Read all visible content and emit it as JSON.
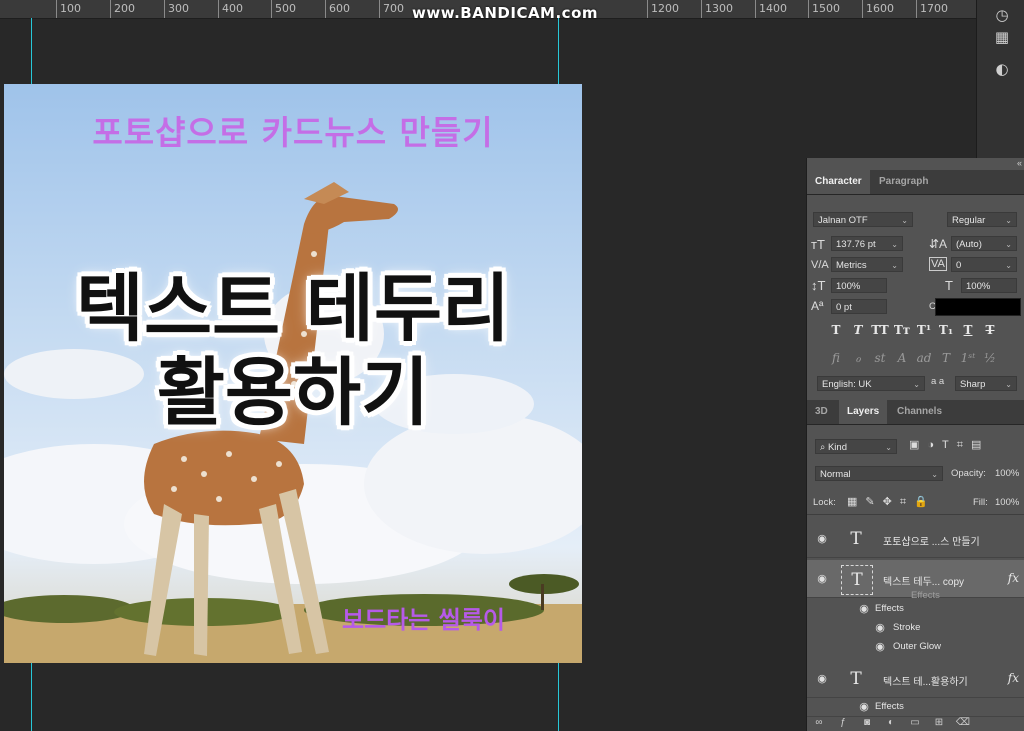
{
  "watermark": "www.BANDICAM.com",
  "ruler": {
    "labels": [
      "100",
      "200",
      "300",
      "400",
      "500",
      "600",
      "700",
      "1200",
      "1300",
      "1400",
      "1500",
      "1600",
      "1700"
    ]
  },
  "card": {
    "title": "포토샵으로 카드뉴스 만들기",
    "main_line1": "텍스트 테두리",
    "main_line2": "활용하기",
    "author": "보드타는 씰룩이"
  },
  "character_panel": {
    "tabs": [
      "Character",
      "Paragraph"
    ],
    "font_family": "Jalnan OTF",
    "font_style": "Regular",
    "font_size": "137.76 pt",
    "leading": "(Auto)",
    "kerning": "Metrics",
    "tracking": "0",
    "vertical_scale": "100%",
    "horizontal_scale": "100%",
    "baseline_shift": "0 pt",
    "color_label": "Color:",
    "color": "#000000",
    "language": "English: UK",
    "aa_label": "a a",
    "antialias": "Sharp"
  },
  "layers_panel": {
    "tabs": [
      "3D",
      "Layers",
      "Channels"
    ],
    "filter_kind": "Kind",
    "blend_mode": "Normal",
    "opacity_label": "Opacity:",
    "opacity": "100%",
    "lock_label": "Lock:",
    "fill_label": "Fill:",
    "fill": "100%",
    "layers": [
      {
        "name": "포토샵으로 ...스 만들기",
        "thumb": "T"
      },
      {
        "name": "텍스트 테두... copy",
        "thumb": "T",
        "fx": "fx",
        "drag_ghost": "Effects"
      },
      {
        "name": "텍스트 테...활용하기",
        "thumb": "T",
        "fx": "fx"
      }
    ],
    "effects_label": "Effects",
    "stroke_label": "Stroke",
    "outer_glow_label": "Outer Glow",
    "effects_label_2": "Effects"
  }
}
